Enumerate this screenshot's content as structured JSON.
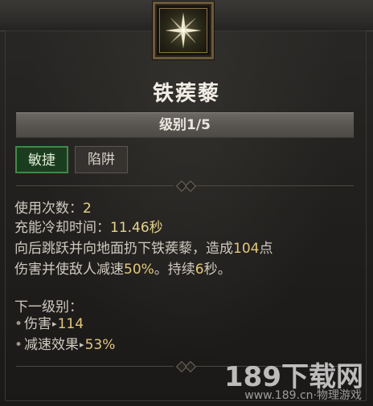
{
  "skill": {
    "name": "铁蒺藜",
    "level_text": "级别1/5",
    "tags": [
      "敏捷",
      "陷阱"
    ]
  },
  "stats": {
    "uses_label": "使用次数：",
    "uses_value": "2",
    "cooldown_label": "充能冷却时间：",
    "cooldown_value": "11.46秒"
  },
  "description": {
    "line1_a": "向后跳跃并向地面扔下铁蒺藜，造成",
    "line1_num": "104",
    "line1_b": "点",
    "line2_a": "伤害并使敌人减速",
    "line2_pct": "50%",
    "line2_b": "。持续",
    "line2_sec": "6",
    "line2_c": "秒。"
  },
  "next_level": {
    "label": "下一级别：",
    "rows": [
      {
        "name": "伤害",
        "value": "114"
      },
      {
        "name": "减速效果",
        "value": "53%"
      }
    ]
  },
  "watermark": {
    "main": "189下载网",
    "sub": "www.189.cn·物理游戏"
  },
  "icons": {
    "skill_icon": "caltrops-star-icon",
    "bullet": "•",
    "arrow": "▸"
  },
  "colors": {
    "value_gold": "#e2c87c",
    "tag_active_green": "#3f8a45"
  }
}
